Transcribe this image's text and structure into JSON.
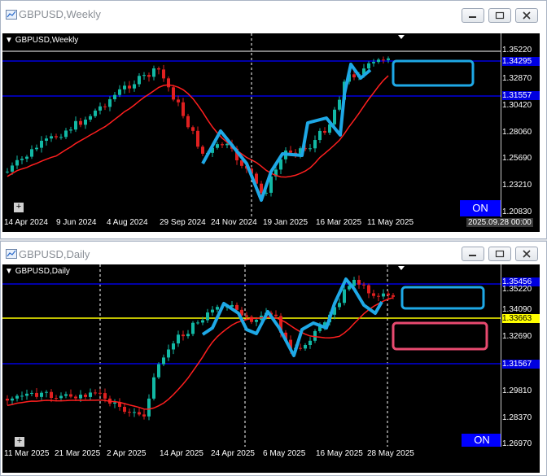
{
  "windows": [
    {
      "title": "GBPUSD,Weekly",
      "chart_label": "GBPUSD,Weekly",
      "on_label": "ON",
      "time_box": "2025.09.28 00:00",
      "price_labels": [
        "1.35220",
        "1.34295",
        "1.32870",
        "1.31557",
        "1.30420",
        "1.28060",
        "1.25690",
        "1.23210",
        "1.20830"
      ],
      "date_labels": [
        "14 Apr 2024",
        "9 Jun 2024",
        "4 Aug 2024",
        "29 Sep 2024",
        "24 Nov 2024",
        "19 Jan 2025",
        "16 Mar 2025",
        "11 May 2025"
      ],
      "colors": {
        "up": "#12b8a4",
        "down": "#e02020",
        "ma": "#ff1f1f",
        "line": "#0000e0",
        "bid": "#ffffff",
        "drawing": "#1ea8e6"
      }
    },
    {
      "title": "GBPUSD,Daily",
      "chart_label": "GBPUSD,Daily",
      "on_label": "ON",
      "price_labels": [
        "1.35456",
        "1.35220",
        "1.34090",
        "1.33663",
        "1.32690",
        "1.31567",
        "1.29810",
        "1.28370",
        "1.26970"
      ],
      "date_labels": [
        "11 Mar 2025",
        "21 Mar 2025",
        "2 Apr 2025",
        "14 Apr 2025",
        "24 Apr 2025",
        "6 May 2025",
        "16 May 2025",
        "28 May 2025"
      ],
      "colors": {
        "up": "#12b8a4",
        "down": "#e02020",
        "ma": "#ff1f1f",
        "line": "#0000e0",
        "support": "#ffff00",
        "drawing": "#1ea8e6",
        "box2": "#e84a70"
      }
    }
  ],
  "window_buttons": [
    "minimize-button",
    "restore-button",
    "close-button"
  ]
}
